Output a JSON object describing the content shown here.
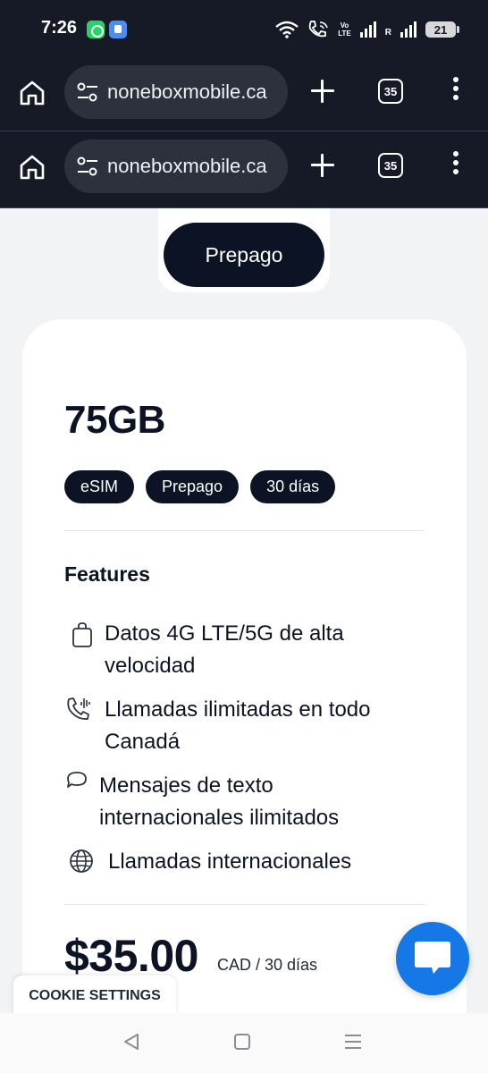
{
  "status_bar": {
    "time": "7:26",
    "volte_label_top": "Vo",
    "volte_label_bottom": "LTE",
    "roaming_label": "R",
    "battery_level": "21"
  },
  "browser": {
    "url_text": "noneboxmobile.ca",
    "tab_count": "35"
  },
  "page": {
    "tab_label": "Prepago",
    "plan_name": "75GB",
    "badges": [
      "eSIM",
      "Prepago",
      "30 días"
    ],
    "features_title": "Features",
    "features": [
      {
        "icon": "bag-icon",
        "text": "Datos 4G LTE/5G de alta velocidad"
      },
      {
        "icon": "phone-call-icon",
        "text": "Llamadas ilimitadas en todo Canadá"
      },
      {
        "icon": "chat-bubble-icon",
        "text": "Mensajes de texto internacionales ilimitados"
      },
      {
        "icon": "globe-icon",
        "text": "Llamadas internacionales"
      }
    ],
    "price": "$35.00",
    "price_unit": "CAD / 30 días"
  },
  "cookie_settings_label": "COOKIE SETTINGS",
  "colors": {
    "dark_navy": "#0b1324",
    "browser_bg": "#151a26",
    "chat_blue": "#1677e6",
    "page_bg": "#f2f3f5"
  }
}
